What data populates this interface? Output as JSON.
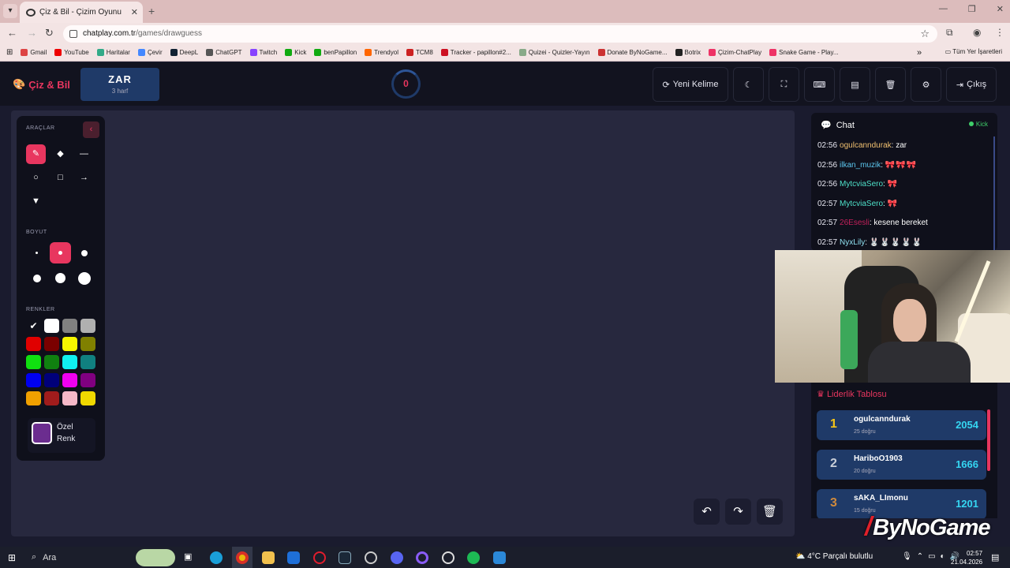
{
  "browser": {
    "tab_title": "Çiz & Bil - Çizim Oyunu",
    "url_host": "chatplay.com.tr",
    "url_path": "/games/drawguess",
    "bookmarks": [
      "Gmail",
      "YouTube",
      "Haritalar",
      "Çevir",
      "DeepL",
      "ChatGPT",
      "Twitch",
      "Kick",
      "benPapillon",
      "Trendyol",
      "TCM8",
      "Tracker - papillon#2...",
      "Quizei - Quizler-Yayın",
      "Donate ByNoGame...",
      "Botrix",
      "Çizim-ChatPlay",
      "Snake Game - Play..."
    ],
    "bookmarks_more": "»",
    "all_bookmarks": "Tüm Yer İşaretleri"
  },
  "app": {
    "logo": "Çiz & Bil",
    "word": "ZAR",
    "word_hint": "3 harf",
    "timer": "0",
    "new_word": "Yeni Kelime",
    "exit": "Çıkış"
  },
  "tools": {
    "tools_title": "ARAÇLAR",
    "size_title": "BOYUT",
    "colors_title": "RENKLER",
    "custom_color_1": "Özel",
    "custom_color_2": "Renk",
    "swatches": [
      "#111111",
      "#ffffff",
      "#808080",
      "#b0b0b0",
      "#e00000",
      "#7a0000",
      "#f5f500",
      "#808000",
      "#10e010",
      "#108010",
      "#10f0f0",
      "#108080",
      "#0000f0",
      "#00007a",
      "#f000f0",
      "#800080",
      "#f0a000",
      "#a01c1c",
      "#f5b8c8",
      "#f0d800"
    ],
    "custom_color": "#6b2d8f"
  },
  "chat": {
    "title": "Chat",
    "live": "Kick",
    "messages": [
      {
        "time": "02:56",
        "user": "ogulcanndurak",
        "color": "#f0c070",
        "text": ": zar",
        "emotes": ""
      },
      {
        "time": "02:56",
        "user": "ilkan_muzik",
        "color": "#5cc8f0",
        "text": ": ",
        "emotes": "🎀🎀🎀"
      },
      {
        "time": "02:56",
        "user": "MytcviaSero",
        "color": "#4ee0c8",
        "text": ": ",
        "emotes": "🎀"
      },
      {
        "time": "02:57",
        "user": "MytcviaSero",
        "color": "#4ee0c8",
        "text": ": ",
        "emotes": "🎀"
      },
      {
        "time": "02:57",
        "user": "26Esesli",
        "color": "#c0205a",
        "text": ": kesene bereket",
        "emotes": ""
      },
      {
        "time": "02:57",
        "user": "NyxLily",
        "color": "#8fe0f0",
        "text": ": ",
        "emotes": "🐰🐰🐰🐰🐰"
      }
    ]
  },
  "leaderboard": {
    "title": "Liderlik Tablosu",
    "rows": [
      {
        "rank": "1",
        "name": "ogulcanndurak",
        "sub": "25 doğru",
        "score": "2054",
        "rank_color": "#f5c518"
      },
      {
        "rank": "2",
        "name": "HariboO1903",
        "sub": "20 doğru",
        "score": "1666",
        "rank_color": "#c9cfd8"
      },
      {
        "rank": "3",
        "name": "sAKA_LImonu",
        "sub": "15 doğru",
        "score": "1201",
        "rank_color": "#d08a3c"
      }
    ]
  },
  "watermark": "ByNoGame",
  "taskbar": {
    "search": "Ara",
    "weather": "4°C  Parçalı bulutlu",
    "time": "02:57",
    "date": "21.04.2026"
  }
}
